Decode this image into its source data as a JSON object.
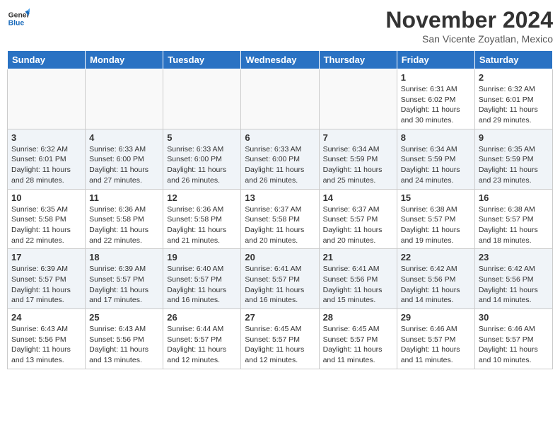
{
  "header": {
    "logo": {
      "line1": "General",
      "line2": "Blue"
    },
    "title": "November 2024",
    "location": "San Vicente Zoyatlan, Mexico"
  },
  "days_of_week": [
    "Sunday",
    "Monday",
    "Tuesday",
    "Wednesday",
    "Thursday",
    "Friday",
    "Saturday"
  ],
  "weeks": [
    [
      {
        "day": "",
        "info": ""
      },
      {
        "day": "",
        "info": ""
      },
      {
        "day": "",
        "info": ""
      },
      {
        "day": "",
        "info": ""
      },
      {
        "day": "",
        "info": ""
      },
      {
        "day": "1",
        "info": "Sunrise: 6:31 AM\nSunset: 6:02 PM\nDaylight: 11 hours and 30 minutes."
      },
      {
        "day": "2",
        "info": "Sunrise: 6:32 AM\nSunset: 6:01 PM\nDaylight: 11 hours and 29 minutes."
      }
    ],
    [
      {
        "day": "3",
        "info": "Sunrise: 6:32 AM\nSunset: 6:01 PM\nDaylight: 11 hours and 28 minutes."
      },
      {
        "day": "4",
        "info": "Sunrise: 6:33 AM\nSunset: 6:00 PM\nDaylight: 11 hours and 27 minutes."
      },
      {
        "day": "5",
        "info": "Sunrise: 6:33 AM\nSunset: 6:00 PM\nDaylight: 11 hours and 26 minutes."
      },
      {
        "day": "6",
        "info": "Sunrise: 6:33 AM\nSunset: 6:00 PM\nDaylight: 11 hours and 26 minutes."
      },
      {
        "day": "7",
        "info": "Sunrise: 6:34 AM\nSunset: 5:59 PM\nDaylight: 11 hours and 25 minutes."
      },
      {
        "day": "8",
        "info": "Sunrise: 6:34 AM\nSunset: 5:59 PM\nDaylight: 11 hours and 24 minutes."
      },
      {
        "day": "9",
        "info": "Sunrise: 6:35 AM\nSunset: 5:59 PM\nDaylight: 11 hours and 23 minutes."
      }
    ],
    [
      {
        "day": "10",
        "info": "Sunrise: 6:35 AM\nSunset: 5:58 PM\nDaylight: 11 hours and 22 minutes."
      },
      {
        "day": "11",
        "info": "Sunrise: 6:36 AM\nSunset: 5:58 PM\nDaylight: 11 hours and 22 minutes."
      },
      {
        "day": "12",
        "info": "Sunrise: 6:36 AM\nSunset: 5:58 PM\nDaylight: 11 hours and 21 minutes."
      },
      {
        "day": "13",
        "info": "Sunrise: 6:37 AM\nSunset: 5:58 PM\nDaylight: 11 hours and 20 minutes."
      },
      {
        "day": "14",
        "info": "Sunrise: 6:37 AM\nSunset: 5:57 PM\nDaylight: 11 hours and 20 minutes."
      },
      {
        "day": "15",
        "info": "Sunrise: 6:38 AM\nSunset: 5:57 PM\nDaylight: 11 hours and 19 minutes."
      },
      {
        "day": "16",
        "info": "Sunrise: 6:38 AM\nSunset: 5:57 PM\nDaylight: 11 hours and 18 minutes."
      }
    ],
    [
      {
        "day": "17",
        "info": "Sunrise: 6:39 AM\nSunset: 5:57 PM\nDaylight: 11 hours and 17 minutes."
      },
      {
        "day": "18",
        "info": "Sunrise: 6:39 AM\nSunset: 5:57 PM\nDaylight: 11 hours and 17 minutes."
      },
      {
        "day": "19",
        "info": "Sunrise: 6:40 AM\nSunset: 5:57 PM\nDaylight: 11 hours and 16 minutes."
      },
      {
        "day": "20",
        "info": "Sunrise: 6:41 AM\nSunset: 5:57 PM\nDaylight: 11 hours and 16 minutes."
      },
      {
        "day": "21",
        "info": "Sunrise: 6:41 AM\nSunset: 5:56 PM\nDaylight: 11 hours and 15 minutes."
      },
      {
        "day": "22",
        "info": "Sunrise: 6:42 AM\nSunset: 5:56 PM\nDaylight: 11 hours and 14 minutes."
      },
      {
        "day": "23",
        "info": "Sunrise: 6:42 AM\nSunset: 5:56 PM\nDaylight: 11 hours and 14 minutes."
      }
    ],
    [
      {
        "day": "24",
        "info": "Sunrise: 6:43 AM\nSunset: 5:56 PM\nDaylight: 11 hours and 13 minutes."
      },
      {
        "day": "25",
        "info": "Sunrise: 6:43 AM\nSunset: 5:56 PM\nDaylight: 11 hours and 13 minutes."
      },
      {
        "day": "26",
        "info": "Sunrise: 6:44 AM\nSunset: 5:57 PM\nDaylight: 11 hours and 12 minutes."
      },
      {
        "day": "27",
        "info": "Sunrise: 6:45 AM\nSunset: 5:57 PM\nDaylight: 11 hours and 12 minutes."
      },
      {
        "day": "28",
        "info": "Sunrise: 6:45 AM\nSunset: 5:57 PM\nDaylight: 11 hours and 11 minutes."
      },
      {
        "day": "29",
        "info": "Sunrise: 6:46 AM\nSunset: 5:57 PM\nDaylight: 11 hours and 11 minutes."
      },
      {
        "day": "30",
        "info": "Sunrise: 6:46 AM\nSunset: 5:57 PM\nDaylight: 11 hours and 10 minutes."
      }
    ]
  ]
}
